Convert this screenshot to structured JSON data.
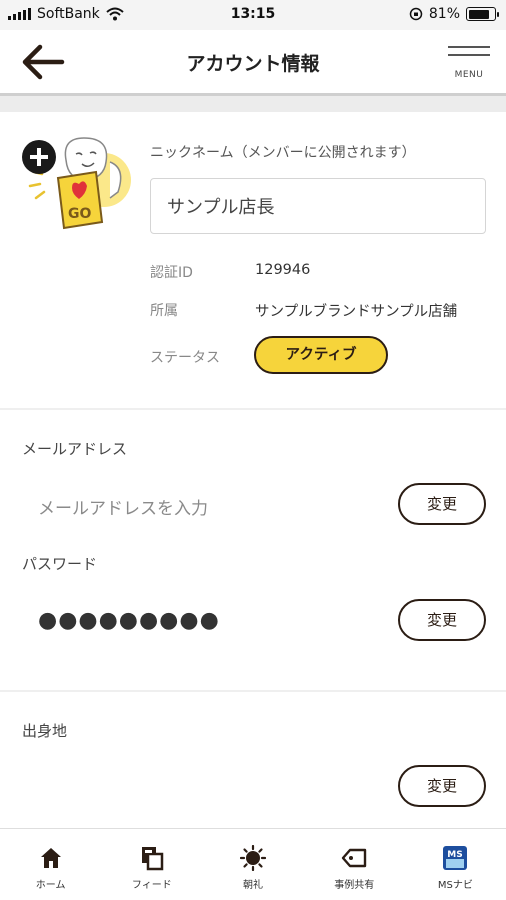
{
  "status_bar": {
    "carrier": "SoftBank",
    "time": "13:15",
    "battery_percent": 81,
    "battery_text": "81%"
  },
  "header": {
    "title": "アカウント情報",
    "menu_label": "MENU"
  },
  "profile": {
    "nickname_label": "ニックネーム（メンバーに公開されます）",
    "nickname_value": "サンプル店長",
    "auth_id_label": "認証ID",
    "auth_id_value": "129946",
    "affiliation_label": "所属",
    "affiliation_value": "サンプルブランドサンプル店舗",
    "status_label": "ステータス",
    "status_value": "アクティブ"
  },
  "email": {
    "label": "メールアドレス",
    "value": "メールアドレスを入力",
    "change_label": "変更"
  },
  "password": {
    "label": "パスワード",
    "value": "●●●●●●●●●",
    "change_label": "変更"
  },
  "hometown": {
    "label": "出身地",
    "change_label": "変更"
  },
  "tabs": [
    {
      "label": "ホーム",
      "icon": "home-icon"
    },
    {
      "label": "フィード",
      "icon": "feed-icon"
    },
    {
      "label": "朝礼",
      "icon": "sun-icon"
    },
    {
      "label": "事例共有",
      "icon": "tag-icon"
    },
    {
      "label": "MSナビ",
      "icon": "ms-navi-icon"
    }
  ],
  "colors": {
    "accent_yellow": "#f6d43b",
    "dark_brown": "#2b1d14"
  }
}
